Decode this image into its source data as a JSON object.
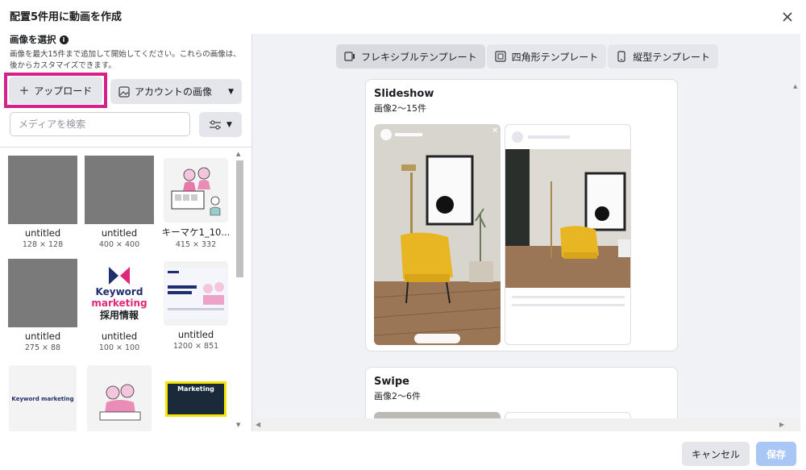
{
  "dialog": {
    "title": "配置5件用に動画を作成",
    "close_label": "✕"
  },
  "left": {
    "section_title": "画像を選択",
    "description": "画像を最大15件まで追加して開始してください。これらの画像は、後からカスタマイズできます。",
    "upload_label": "アップロード",
    "upload_icon": "+",
    "account_images_label": "アカウントの画像",
    "search_placeholder": "メディアを検索",
    "images": [
      {
        "name": "untitled",
        "dims": "128 × 128"
      },
      {
        "name": "untitled",
        "dims": "400 × 400"
      },
      {
        "name": "キーマケ1_10...",
        "dims": "415 × 332"
      },
      {
        "name": "untitled",
        "dims": "275 × 88"
      },
      {
        "name": "untitled",
        "dims": "100 × 100"
      },
      {
        "name": "untitled",
        "dims": "1200 × 851"
      }
    ],
    "logo_text": {
      "brand_top": "Keyword",
      "brand_bottom": "marketing",
      "recruit": "採用情報",
      "wide_logo": "Keyword marketing",
      "tile9_label": "Marketing"
    }
  },
  "right": {
    "tabs": [
      {
        "label": "フレキシブルテンプレート",
        "active": true
      },
      {
        "label": "四角形テンプレート",
        "active": false
      },
      {
        "label": "縦型テンプレート",
        "active": false
      }
    ],
    "templates": [
      {
        "title": "Slideshow",
        "subtitle": "画像2〜15件"
      },
      {
        "title": "Swipe",
        "subtitle": "画像2〜6件"
      }
    ]
  },
  "footer": {
    "cancel_label": "キャンセル",
    "save_label": "保存"
  },
  "colors": {
    "highlight": "#d4218a",
    "save_disabled": "#a9c7f5",
    "brand_pink": "#e0287a",
    "brand_navy": "#1f2f6e"
  }
}
